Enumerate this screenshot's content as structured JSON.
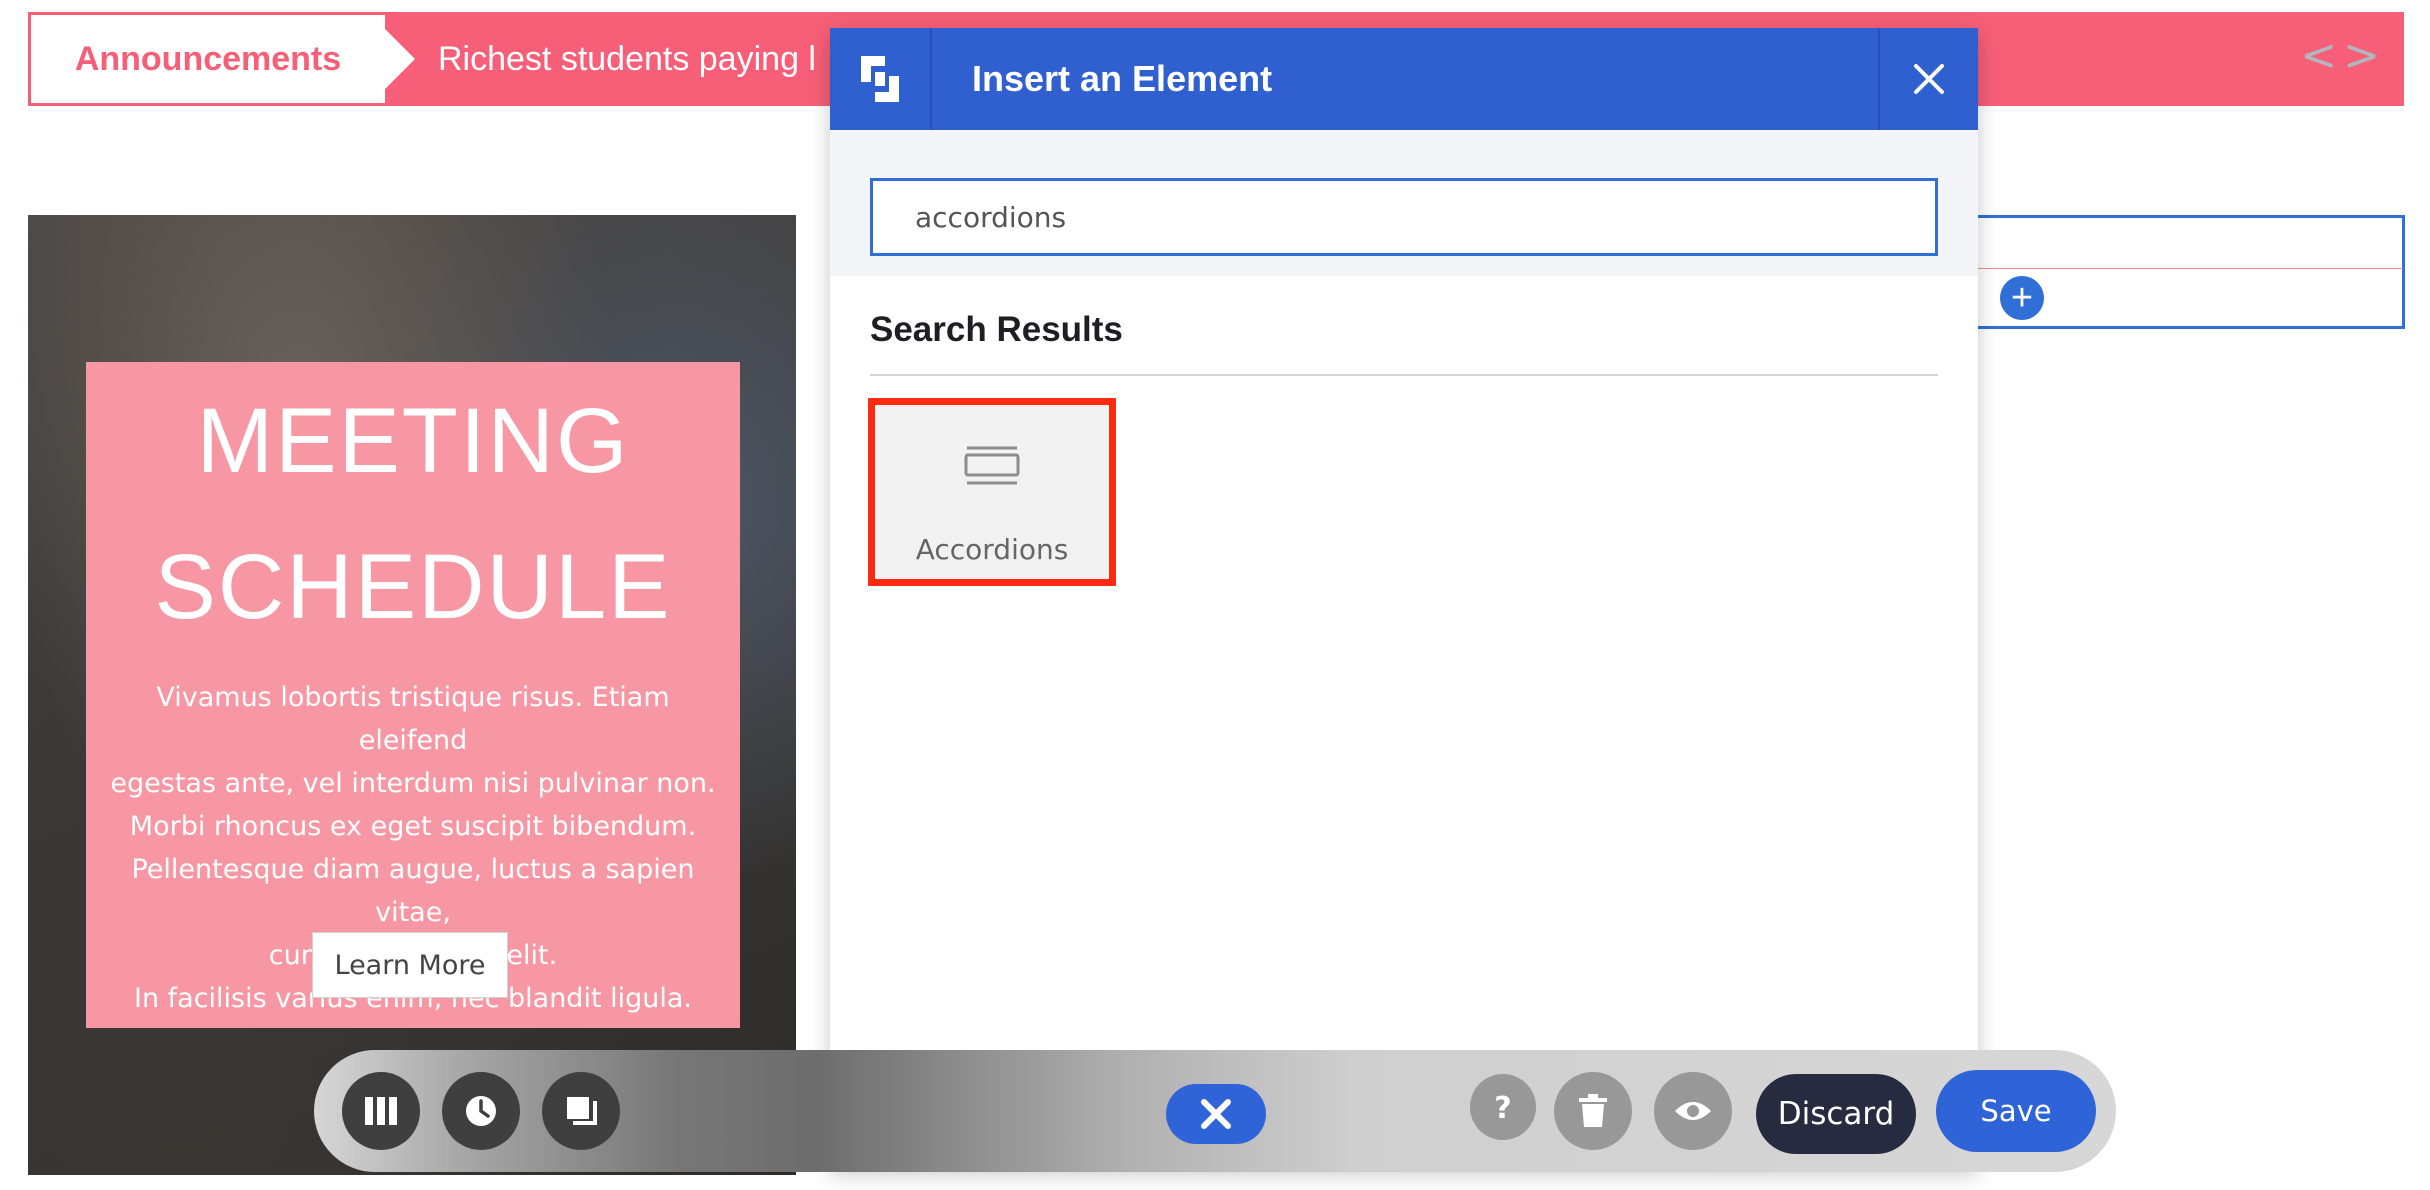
{
  "announcement": {
    "label": "Announcements",
    "text": "Richest students paying l",
    "nav": "<>"
  },
  "hero": {
    "title_line1": "MEETING",
    "title_line2": "SCHEDULE",
    "body": [
      "Vivamus lobortis tristique risus. Etiam eleifend",
      "egestas ante, vel interdum nisi pulvinar non.",
      "Morbi rhoncus ex eget suscipit bibendum.",
      "Pellentesque diam augue, luctus a sapien vitae,",
      "cursus venenatis elit.",
      "In facilisis varius enim, nec blandit ligula."
    ],
    "button_label": "Learn More"
  },
  "modal": {
    "title": "Insert an Element",
    "search_value": "accordions",
    "results_title": "Search Results",
    "results": [
      {
        "label": "Accordions",
        "icon": "accordion-icon"
      }
    ]
  },
  "toolbar": {
    "left_icons": [
      "columns-icon",
      "clock-icon",
      "layers-icon"
    ],
    "right_icons": [
      "help-icon",
      "trash-icon",
      "eye-icon"
    ],
    "discard_label": "Discard",
    "save_label": "Save"
  },
  "colors": {
    "announcement": "#f75f78",
    "primary": "#3060d0",
    "card": "#f797a4",
    "highlight": "#ff2a12",
    "dark_button": "#262b40"
  }
}
